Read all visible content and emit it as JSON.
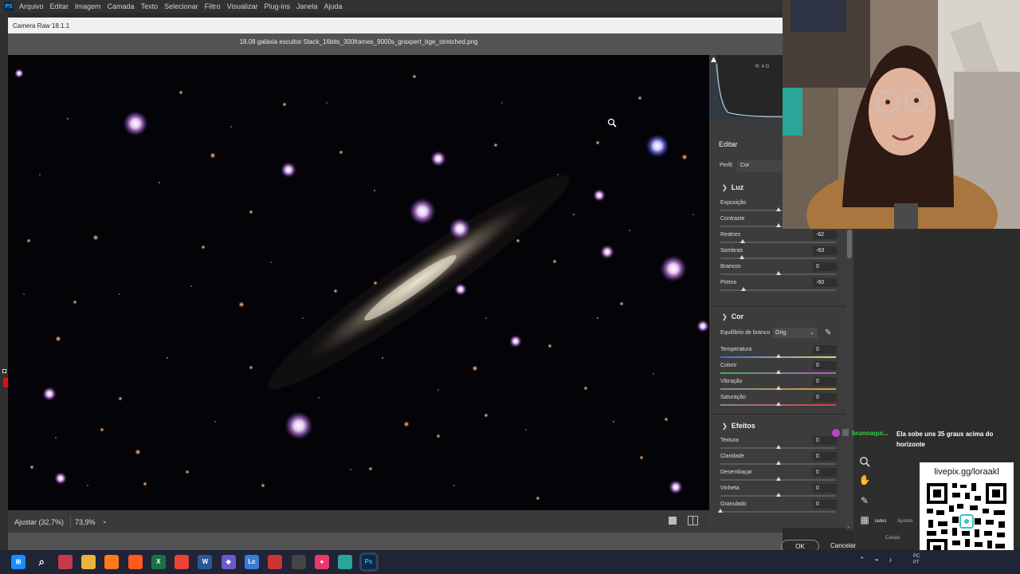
{
  "menubar": {
    "app_icon": "PS",
    "items": [
      "Arquivo",
      "Editar",
      "Imagem",
      "Camada",
      "Texto",
      "Selecionar",
      "Filtro",
      "Visualizar",
      "Plug-ins",
      "Janela",
      "Ajuda"
    ]
  },
  "camera_raw": {
    "window_title": "Camera Raw 18.1.1",
    "filename": "18.08 galáxia escultor Stack_16bits_300frames_9000s_graxpert_bge_stretched.png",
    "bottom": {
      "fit_label": "Ajustar (32,7%)",
      "zoom_value": "73,9%",
      "zoom_chevron": "⌄"
    },
    "histogram_info": "R: 4    G",
    "edit_title": "Editar",
    "profile": {
      "label": "Perfil",
      "value": "Cor"
    },
    "sections": {
      "luz": {
        "title": "Luz",
        "sliders": [
          {
            "label": "Exposição",
            "value": "",
            "fraction": 0.5
          },
          {
            "label": "Contraste",
            "value": "",
            "fraction": 0.5
          },
          {
            "label": "Realces",
            "value": "-62",
            "fraction": 0.19
          },
          {
            "label": "Sombras",
            "value": "-63",
            "fraction": 0.185
          },
          {
            "label": "Brancos",
            "value": "0",
            "fraction": 0.5
          },
          {
            "label": "Pretos",
            "value": "-60",
            "fraction": 0.2
          }
        ]
      },
      "cor": {
        "title": "Cor",
        "white_balance_label": "Equilíbrio de branco",
        "white_balance_value": "Orig.",
        "sliders": [
          {
            "label": "Temperatura",
            "value": "0",
            "fraction": 0.5
          },
          {
            "label": "Colorir",
            "value": "0",
            "fraction": 0.5
          },
          {
            "label": "Vibração",
            "value": "0",
            "fraction": 0.5
          },
          {
            "label": "Saturação",
            "value": "0",
            "fraction": 0.5
          }
        ]
      },
      "efeitos": {
        "title": "Efeitos",
        "sliders": [
          {
            "label": "Textura",
            "value": "0",
            "fraction": 0.5
          },
          {
            "label": "Claridade",
            "value": "0",
            "fraction": 0.5
          },
          {
            "label": "Desembaçar",
            "value": "0",
            "fraction": 0.5
          },
          {
            "label": "Vinheta",
            "value": "0",
            "fraction": 0.5
          },
          {
            "label": "Granulado",
            "value": "0",
            "fraction": 0.0
          }
        ]
      }
    },
    "ok_label": "OK",
    "cancel_label": "Cancelar"
  },
  "right_tabs": {
    "props": "lades",
    "adjust": "Ajustes",
    "channels": "Canais"
  },
  "chat": {
    "username": "brunoaqui...",
    "message": "Ela sobe uns 35 graus acima do horizonte"
  },
  "livepix": {
    "title": "livepix.gg/loraakl"
  },
  "taskbar": {
    "icons": [
      "windows-start",
      "search",
      "ws",
      "file-explorer",
      "firefox",
      "brave",
      "excel",
      "chrome",
      "word",
      "app",
      "lc",
      "app2",
      "obs",
      "app3",
      "app4",
      "photoshop"
    ],
    "tray_lang": "PC\nPT"
  },
  "colors": {
    "accent_chat_user": "#36d14b",
    "star_pink": "#b06ad0",
    "ps_blue": "#31a8ff"
  }
}
